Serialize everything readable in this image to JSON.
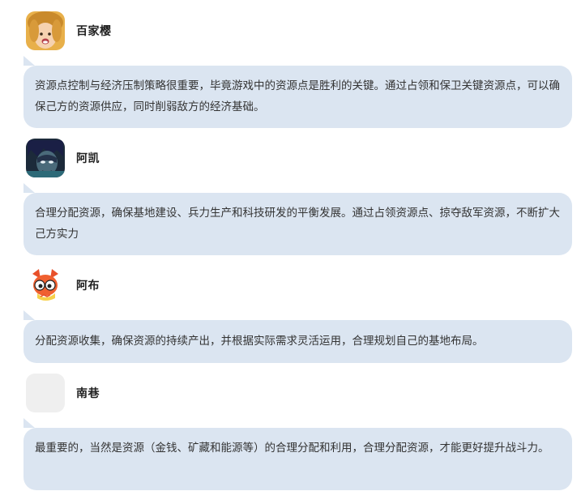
{
  "comments": [
    {
      "name": "百家樱",
      "avatar_icon": "child-photo-avatar",
      "text": "资源点控制与经济压制策略很重要，毕竟游戏中的资源点是胜利的关键。通过占领和保卫关键资源点，可以确保己方的资源供应，同时削弱敌方的经济基础。"
    },
    {
      "name": "阿凯",
      "avatar_icon": "anime-boy-avatar",
      "text": "合理分配资源，确保基地建设、兵力生产和科技研发的平衡发展。通过占领资源点、掠夺敌军资源，不断扩大己方实力"
    },
    {
      "name": "阿布",
      "avatar_icon": "cartoon-fox-avatar",
      "text": "分配资源收集，确保资源的持续产出，并根据实际需求灵活运用，合理规划自己的基地布局。"
    },
    {
      "name": "南巷",
      "avatar_icon": "blank-avatar",
      "text": "最重要的，当然是资源（金钱、矿藏和能源等）的合理分配和利用，合理分配资源，才能更好提升战斗力。"
    }
  ],
  "colors": {
    "bubble_bg": "#dbe5f1",
    "name_text": "#222222",
    "body_text": "#333333"
  }
}
